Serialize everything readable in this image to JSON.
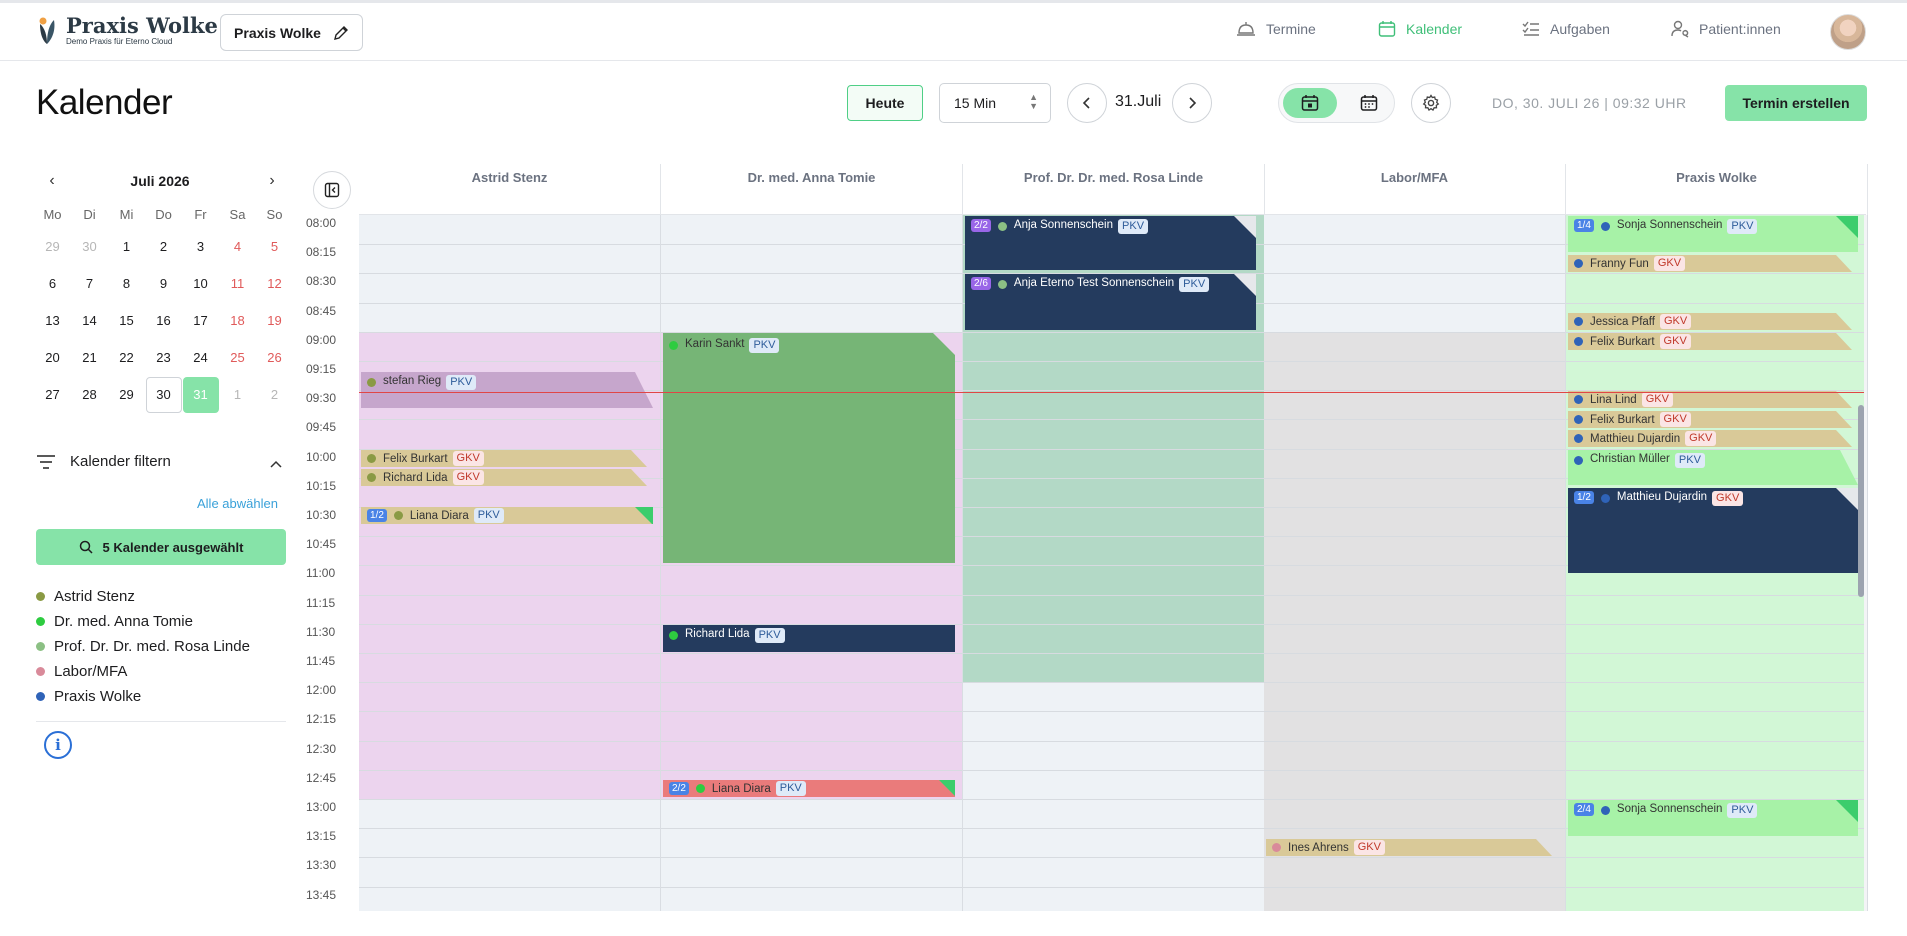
{
  "header": {
    "logo_name": "Praxis Wolke",
    "logo_sub": "Demo Praxis für Eterno Cloud",
    "praxis_button": "Praxis Wolke",
    "nav": [
      {
        "label": "Termine",
        "active": false
      },
      {
        "label": "Kalender",
        "active": true
      },
      {
        "label": "Aufgaben",
        "active": false
      },
      {
        "label": "Patient:innen",
        "active": false
      }
    ]
  },
  "toolbar": {
    "title": "Kalender",
    "today_label": "Heute",
    "interval_value": "15 Min",
    "current_date": "31.Juli",
    "datetime": "DO, 30. JULI 26 | 09:32 UHR",
    "create_label": "Termin erstellen"
  },
  "mini_calendar": {
    "month_label": "Juli 2026",
    "weekdays": [
      "Mo",
      "Di",
      "Mi",
      "Do",
      "Fr",
      "Sa",
      "So"
    ],
    "weeks": [
      [
        "29",
        "30",
        "1",
        "2",
        "3",
        "4",
        "5"
      ],
      [
        "6",
        "7",
        "8",
        "9",
        "10",
        "11",
        "12"
      ],
      [
        "13",
        "14",
        "15",
        "16",
        "17",
        "18",
        "19"
      ],
      [
        "20",
        "21",
        "22",
        "23",
        "24",
        "25",
        "26"
      ],
      [
        "27",
        "28",
        "29",
        "30",
        "31",
        "1",
        "2"
      ]
    ],
    "today": "30",
    "selected": "31"
  },
  "filter": {
    "title": "Kalender filtern",
    "deselect_all": "Alle abwählen",
    "selected_button": "5 Kalender ausgewählt",
    "calendars": [
      {
        "name": "Astrid Stenz",
        "color": "#8a9a44"
      },
      {
        "name": "Dr. med. Anna Tomie",
        "color": "#2ecc40"
      },
      {
        "name": "Prof. Dr. Dr. med. Rosa Linde",
        "color": "#8cc084"
      },
      {
        "name": "Labor/MFA",
        "color": "#d98a9a"
      },
      {
        "name": "Praxis Wolke",
        "color": "#2f63b8"
      }
    ]
  },
  "grid": {
    "columns": [
      "Astrid Stenz",
      "Dr. med. Anna Tomie",
      "Prof. Dr. Dr. med. Rosa Linde",
      "Labor/MFA",
      "Praxis Wolke"
    ],
    "times": [
      "08:00",
      "08:15",
      "08:30",
      "08:45",
      "09:00",
      "09:15",
      "09:30",
      "09:45",
      "10:00",
      "10:15",
      "10:30",
      "10:45",
      "11:00",
      "11:15",
      "11:30",
      "11:45",
      "12:00",
      "12:15",
      "12:30",
      "12:45",
      "13:00",
      "13:15",
      "13:30",
      "13:45"
    ]
  },
  "events": {
    "astrid": [
      {
        "name": "stefan Rieg",
        "ins": "PKV"
      },
      {
        "name": "Felix Burkart",
        "ins": "GKV"
      },
      {
        "name": "Richard Lida",
        "ins": "GKV"
      },
      {
        "count": "1/2",
        "name": "Liana Diara",
        "ins": "PKV"
      }
    ],
    "anna": [
      {
        "name": "Karin Sankt",
        "ins": "PKV"
      },
      {
        "name": "Richard Lida",
        "ins": "PKV"
      },
      {
        "count": "2/2",
        "name": "Liana Diara",
        "ins": "PKV"
      }
    ],
    "rosa": [
      {
        "count": "2/2",
        "name": "Anja Sonnenschein",
        "ins": "PKV"
      },
      {
        "count": "2/6",
        "name": "Anja Eterno Test Sonnenschein",
        "ins": "PKV"
      }
    ],
    "labor": [
      {
        "name": "Ines Ahrens",
        "ins": "GKV"
      }
    ],
    "praxis": [
      {
        "count": "1/4",
        "name": "Sonja Sonnenschein",
        "ins": "PKV"
      },
      {
        "name": "Franny Fun",
        "ins": "GKV"
      },
      {
        "name": "Jessica Pfaff",
        "ins": "GKV"
      },
      {
        "name": "Felix Burkart",
        "ins": "GKV"
      },
      {
        "name": "Lina Lind",
        "ins": "GKV"
      },
      {
        "name": "Felix Burkart",
        "ins": "GKV"
      },
      {
        "name": "Matthieu Dujardin",
        "ins": "GKV"
      },
      {
        "name": "Christian Müller",
        "ins": "PKV"
      },
      {
        "count": "1/2",
        "name": "Matthieu Dujardin",
        "ins": "GKV"
      },
      {
        "count": "2/4",
        "name": "Sonja Sonnenschein",
        "ins": "PKV"
      }
    ]
  }
}
